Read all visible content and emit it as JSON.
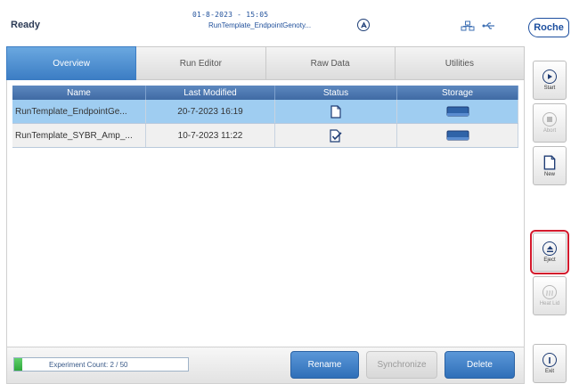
{
  "status": {
    "state": "Ready",
    "datetime": "01-8-2023 - 15:05",
    "run_name": "RunTemplate_EndpointGenoty..."
  },
  "brand": {
    "logo": "Roche",
    "color": "#1d4f9f"
  },
  "tabs": [
    {
      "label": "Overview",
      "active": true
    },
    {
      "label": "Run Editor",
      "active": false
    },
    {
      "label": "Raw Data",
      "active": false
    },
    {
      "label": "Utilities",
      "active": false
    }
  ],
  "table": {
    "headers": [
      "Name",
      "Last Modified",
      "Status",
      "Storage"
    ],
    "rows": [
      {
        "name": "RunTemplate_EndpointGe...",
        "modified": "20-7-2023 16:19",
        "status_icon": "document-icon",
        "storage_icon": "drive-icon",
        "selected": true
      },
      {
        "name": "RunTemplate_SYBR_Amp_...",
        "modified": "10-7-2023 11:22",
        "status_icon": "document-check-icon",
        "storage_icon": "drive-icon",
        "selected": false
      }
    ]
  },
  "footer": {
    "experiment_count": "Experiment Count: 2 / 50",
    "rename": "Rename",
    "synchronize": "Synchronize",
    "delete": "Delete"
  },
  "sidebar": {
    "start": "Start",
    "abort": "Abort",
    "new": "New",
    "eject": "Eject",
    "heat_lid": "Heat Lid",
    "exit": "Exit"
  },
  "colors": {
    "accent": "#3c7dc4",
    "selected_row": "#9fcdf1",
    "highlight": "#d3192c"
  }
}
